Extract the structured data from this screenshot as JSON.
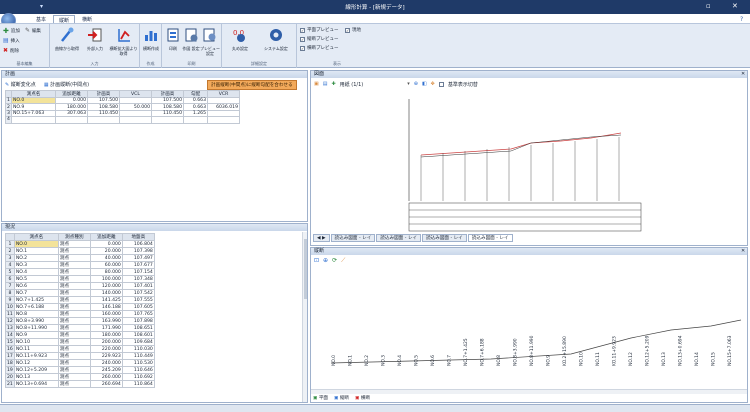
{
  "app": {
    "title": "線形計算 - [新規データ]"
  },
  "colors": {
    "titlebar": "#1f3a68",
    "accent": "#d9893b",
    "select": "#f3e39a"
  },
  "tabs": [
    "基本",
    "縦断",
    "横断"
  ],
  "ribbon": {
    "groups": [
      {
        "label": "基本編集",
        "small": [
          {
            "icon": "add-icon",
            "label": "追加"
          },
          {
            "icon": "edit-icon",
            "label": "編集"
          },
          {
            "icon": "insert-icon",
            "label": "挿入"
          },
          {
            "icon": "delete-icon",
            "label": "削除"
          }
        ]
      },
      {
        "label": "入力",
        "big": [
          {
            "icon": "curve-input-icon",
            "label": "曲線から取得"
          },
          {
            "icon": "import-icon",
            "label": "外部入力"
          },
          {
            "icon": "vertical-curve-icon",
            "label": "横断拡大図より取得"
          }
        ]
      },
      {
        "label": "作成",
        "big": [
          {
            "icon": "chart-create-icon",
            "label": "横断作成"
          }
        ]
      },
      {
        "label": "印刷",
        "big": [
          {
            "icon": "print-icon",
            "label": "印刷"
          },
          {
            "icon": "print-settings-icon",
            "label": "作図\n設定"
          },
          {
            "icon": "preview-icon",
            "label": "プレビュー\n設定"
          }
        ]
      },
      {
        "label": "詳細設定",
        "big": [
          {
            "icon": "calc-settings-icon",
            "label": "丸め設定"
          },
          {
            "icon": "system-settings-icon",
            "label": "システム設定"
          }
        ]
      },
      {
        "label": "表示",
        "checks": [
          "平面プレビュー",
          "縦断プレビュー",
          "横断プレビュー"
        ],
        "extra": "現地"
      }
    ]
  },
  "plan": {
    "title": "計画",
    "toolbar": [
      "縦断変化点",
      "計画縦断(中間点)"
    ],
    "accent_button": "計画縦断(中間点)に縦断勾配を合わせる",
    "columns": [
      "測点名",
      "追加距離",
      "計画高",
      "VCL",
      "計画高",
      "勾配",
      "VCR"
    ],
    "rows": [
      [
        "1",
        "NO.0",
        "0.000",
        "107.500",
        "",
        "107.500",
        "0.663",
        ""
      ],
      [
        "2",
        "NO.9",
        "180.000",
        "108.580",
        "50.000",
        "108.580",
        "0.663",
        "6036.019"
      ],
      [
        "3",
        "NO.15+7.063",
        "307.063",
        "110.450",
        "",
        "110.450",
        "1.265",
        ""
      ],
      [
        "4",
        "",
        "",
        "",
        "",
        "",
        "",
        ""
      ]
    ]
  },
  "current": {
    "title": "現況",
    "columns": [
      "測点名",
      "測点種別",
      "追加距離",
      "地盤高"
    ],
    "rows": [
      [
        "1",
        "NO.0",
        "測点",
        "0.000",
        "106.804"
      ],
      [
        "2",
        "NO.1",
        "測点",
        "20.000",
        "107.398"
      ],
      [
        "3",
        "NO.2",
        "測点",
        "40.000",
        "107.497"
      ],
      [
        "4",
        "NO.3",
        "測点",
        "60.000",
        "107.677"
      ],
      [
        "5",
        "NO.4",
        "測点",
        "80.000",
        "107.154"
      ],
      [
        "6",
        "NO.5",
        "測点",
        "100.000",
        "107.348"
      ],
      [
        "7",
        "NO.6",
        "測点",
        "120.000",
        "107.401"
      ],
      [
        "8",
        "NO.7",
        "測点",
        "140.000",
        "107.542"
      ],
      [
        "9",
        "NO.7+1.425",
        "測点",
        "141.425",
        "107.555"
      ],
      [
        "10",
        "NO.7+6.188",
        "測点",
        "146.188",
        "107.605"
      ],
      [
        "11",
        "NO.8",
        "測点",
        "160.000",
        "107.765"
      ],
      [
        "12",
        "NO.8+3.990",
        "測点",
        "163.990",
        "107.898"
      ],
      [
        "13",
        "NO.8+11.990",
        "測点",
        "171.990",
        "108.651"
      ],
      [
        "14",
        "NO.9",
        "測点",
        "180.000",
        "108.601"
      ],
      [
        "15",
        "NO.10",
        "測点",
        "200.000",
        "109.684"
      ],
      [
        "16",
        "NO.11",
        "測点",
        "220.000",
        "110.030"
      ],
      [
        "17",
        "NO.11+9.923",
        "測点",
        "229.923",
        "110.449"
      ],
      [
        "18",
        "NO.12",
        "測点",
        "240.000",
        "110.530"
      ],
      [
        "19",
        "NO.12+5.209",
        "測点",
        "245.209",
        "110.646"
      ],
      [
        "20",
        "NO.13",
        "測点",
        "260.000",
        "110.692"
      ],
      [
        "21",
        "NO.13+0.694",
        "測点",
        "260.694",
        "110.864"
      ]
    ]
  },
  "drawing": {
    "title": "図面",
    "sheet": "用紙 (1/1)",
    "option": "基準表示切替",
    "sheets": [
      "読込み図面 - レイ",
      "読込み図面 - レイ",
      "読込み図面 - レイ",
      "読込み図面 - レイ"
    ]
  },
  "profile": {
    "title": "縦断",
    "labels": [
      "NO.0",
      "NO.1",
      "NO.2",
      "NO.3",
      "NO.4",
      "NO.5",
      "NO.6",
      "NO.7",
      "NO.7+1.425",
      "NO.7+6.188",
      "NO.8",
      "NO.8+3.990",
      "NO.8+11.990",
      "NO.9",
      "KO.2+15.890",
      "NO.10",
      "NO.11",
      "KO.11+9.923",
      "NO.12",
      "NO.12+5.209",
      "NO.13",
      "NO.13+0.694",
      "NO.14",
      "NO.15",
      "NO.15+7.063"
    ]
  },
  "status": {
    "items": [
      "平面",
      "縦断",
      "横断"
    ]
  }
}
